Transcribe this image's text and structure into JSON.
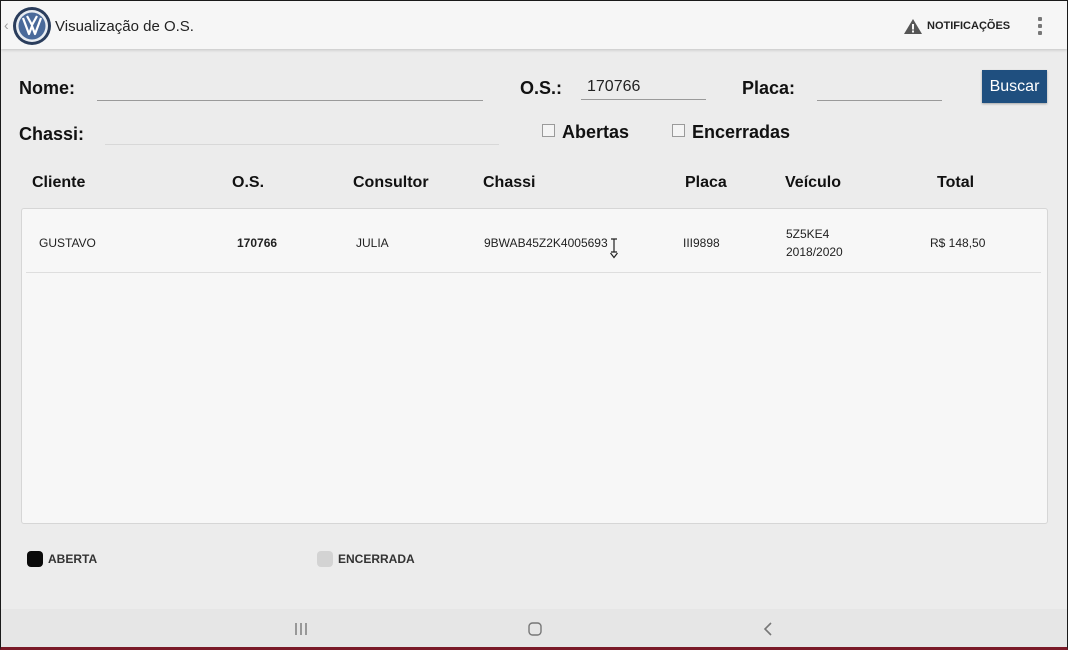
{
  "appbar": {
    "title": "Visualização de O.S.",
    "notifications_label": "NOTIFICAÇÕES",
    "notifications_icon": "warning-triangle-icon",
    "menu_icon": "overflow-menu-icon",
    "logo_icon": "vw-logo-icon"
  },
  "filters": {
    "nome_label": "Nome:",
    "nome_value": "",
    "os_label": "O.S.:",
    "os_value": "170766",
    "placa_label": "Placa:",
    "placa_value": "",
    "chassi_label": "Chassi:",
    "chassi_value": "",
    "buscar_label": "Buscar",
    "abertas_label": "Abertas",
    "encerradas_label": "Encerradas"
  },
  "table": {
    "headers": [
      "Cliente",
      "O.S.",
      "Consultor",
      "Chassi",
      "Placa",
      "Veículo",
      "Total"
    ],
    "rows": [
      {
        "cliente": "GUSTAVO",
        "os": "170766",
        "consultor": "JULIA",
        "chassi": "9BWAB45Z2K4005693",
        "placa": "III9898",
        "veiculo_modelo": "5Z5KE4",
        "veiculo_ano": "2018/2020",
        "total": "R$ 148,50"
      }
    ]
  },
  "legend": {
    "aberta_label": "ABERTA",
    "encerrada_label": "ENCERRADA",
    "aberta_color": "#0a0a0a",
    "encerrada_color": "#d3d3d3"
  },
  "colors": {
    "accent": "#1f4f7f",
    "frame_bottom": "#7a1a28"
  }
}
